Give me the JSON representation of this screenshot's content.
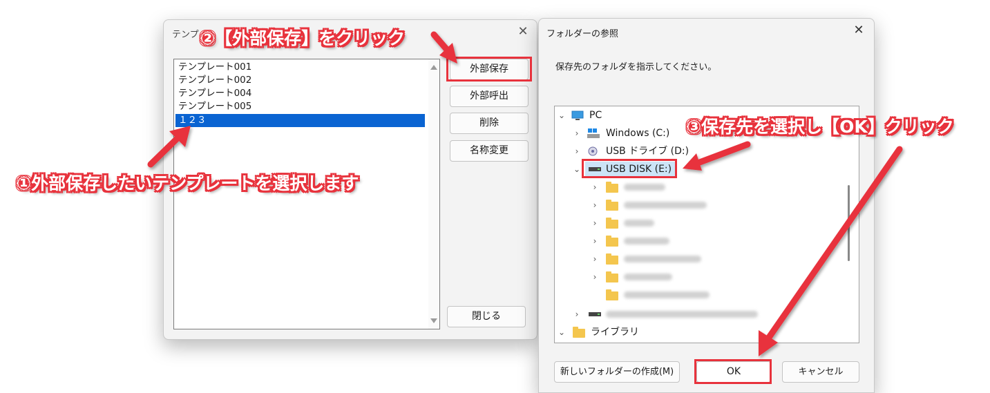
{
  "template_dialog": {
    "title": "テンプ",
    "close": "✕",
    "items": [
      {
        "label": "テンプレート001",
        "selected": false
      },
      {
        "label": "テンプレート002",
        "selected": false
      },
      {
        "label": "テンプレート004",
        "selected": false
      },
      {
        "label": "テンプレート005",
        "selected": false
      },
      {
        "label": "１２３",
        "selected": true
      }
    ],
    "buttons": {
      "export": "外部保存",
      "import": "外部呼出",
      "delete": "削除",
      "rename": "名称変更",
      "close": "閉じる"
    }
  },
  "folder_dialog": {
    "title": "フォルダーの参照",
    "close": "✕",
    "instruction": "保存先のフォルダを指示してください。",
    "tree": {
      "pc": "PC",
      "windows_drive": "Windows (C:)",
      "usb_drive": "USB ドライブ (D:)",
      "usb_disk": "USB DISK (E:)",
      "library": "ライブラリ"
    },
    "buttons": {
      "new_folder": "新しいフォルダーの作成(M)",
      "ok": "OK",
      "cancel": "キャンセル"
    }
  },
  "annotations": {
    "step1": "①外部保存したいテンプレートを選択します",
    "step2": "②【外部保存】をクリック",
    "step3": "③保存先を選択し【OK】クリック"
  },
  "colors": {
    "accent_red": "#e8323c",
    "selection_blue": "#0a64d2",
    "folder_yellow": "#f4c64e"
  }
}
